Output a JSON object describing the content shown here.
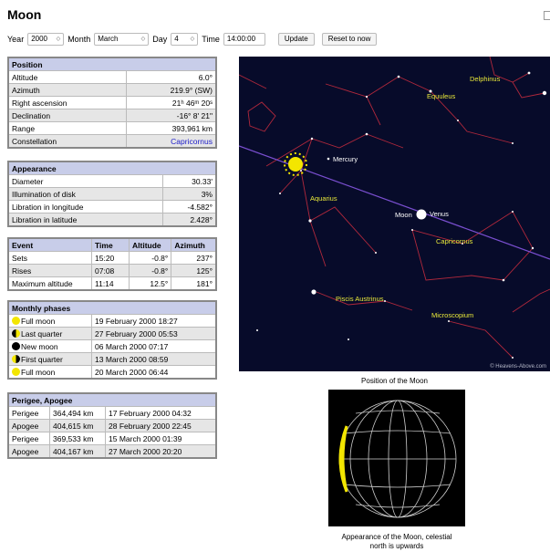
{
  "page": {
    "title": "Moon"
  },
  "controls": {
    "year_label": "Year",
    "year_value": "2000",
    "month_label": "Month",
    "month_value": "March",
    "day_label": "Day",
    "day_value": "4",
    "time_label": "Time",
    "time_value": "14:00:00",
    "update_label": "Update",
    "reset_label": "Reset to now"
  },
  "position": {
    "heading": "Position",
    "rows": [
      {
        "label": "Altitude",
        "value": "6.0°"
      },
      {
        "label": "Azimuth",
        "value": "219.9° (SW)"
      },
      {
        "label": "Right ascension",
        "value": "21ʰ 46ᵐ 20ˢ"
      },
      {
        "label": "Declination",
        "value": "-16° 8' 21\""
      },
      {
        "label": "Range",
        "value": "393,961 km"
      },
      {
        "label": "Constellation",
        "value": "Capricornus"
      }
    ]
  },
  "appearance": {
    "heading": "Appearance",
    "rows": [
      {
        "label": "Diameter",
        "value": "30.33'"
      },
      {
        "label": "Illumination of disk",
        "value": "3%"
      },
      {
        "label": "Libration in longitude",
        "value": "-4.582°"
      },
      {
        "label": "Libration in latitude",
        "value": "2.428°"
      }
    ]
  },
  "events": {
    "headers": [
      "Event",
      "Time",
      "Altitude",
      "Azimuth"
    ],
    "rows": [
      {
        "event": "Sets",
        "time": "15:20",
        "alt": "-0.8°",
        "az": "237°"
      },
      {
        "event": "Rises",
        "time": "07:08",
        "alt": "-0.8°",
        "az": "125°"
      },
      {
        "event": "Maximum altitude",
        "time": "11:14",
        "alt": "12.5°",
        "az": "181°"
      }
    ]
  },
  "phases": {
    "heading": "Monthly phases",
    "rows": [
      {
        "icon": "full-moon-icon",
        "name": "Full moon",
        "date": "19 February 2000 18:27"
      },
      {
        "icon": "last-quarter-icon",
        "name": "Last quarter",
        "date": "27 February 2000 05:53"
      },
      {
        "icon": "new-moon-icon",
        "name": "New moon",
        "date": "06 March 2000 07:17"
      },
      {
        "icon": "first-quarter-icon",
        "name": "First quarter",
        "date": "13 March 2000 08:59"
      },
      {
        "icon": "full-moon-icon",
        "name": "Full moon",
        "date": "20 March 2000 06:44"
      }
    ]
  },
  "perigee": {
    "heading": "Perigee, Apogee",
    "rows": [
      {
        "type": "Perigee",
        "dist": "364,494 km",
        "date": "17 February 2000 04:32"
      },
      {
        "type": "Apogee",
        "dist": "404,615 km",
        "date": "28 February 2000 22:45"
      },
      {
        "type": "Perigee",
        "dist": "369,533 km",
        "date": "15 March 2000 01:39"
      },
      {
        "type": "Apogee",
        "dist": "404,167 km",
        "date": "27 March 2000 20:20"
      }
    ]
  },
  "skymap": {
    "labels": [
      "Delphinus",
      "Equuleus",
      "Mercury",
      "Aquarius",
      "Moon",
      "Venus",
      "Capricornus",
      "Piscis Austrinus",
      "Microscopium"
    ],
    "copyright": "© Heavens-Above.com",
    "caption": "Position of the Moon"
  },
  "moon_view": {
    "caption_line1": "Appearance of the Moon, celestial",
    "caption_line2": "north is upwards"
  },
  "colors": {
    "header_bg": "#c8cde9",
    "sky_bg": "#070b2a",
    "constellation_line": "#b0283c",
    "ecliptic": "#7a4fd0",
    "label": "#e8e83a",
    "link": "#1a1ac8"
  }
}
